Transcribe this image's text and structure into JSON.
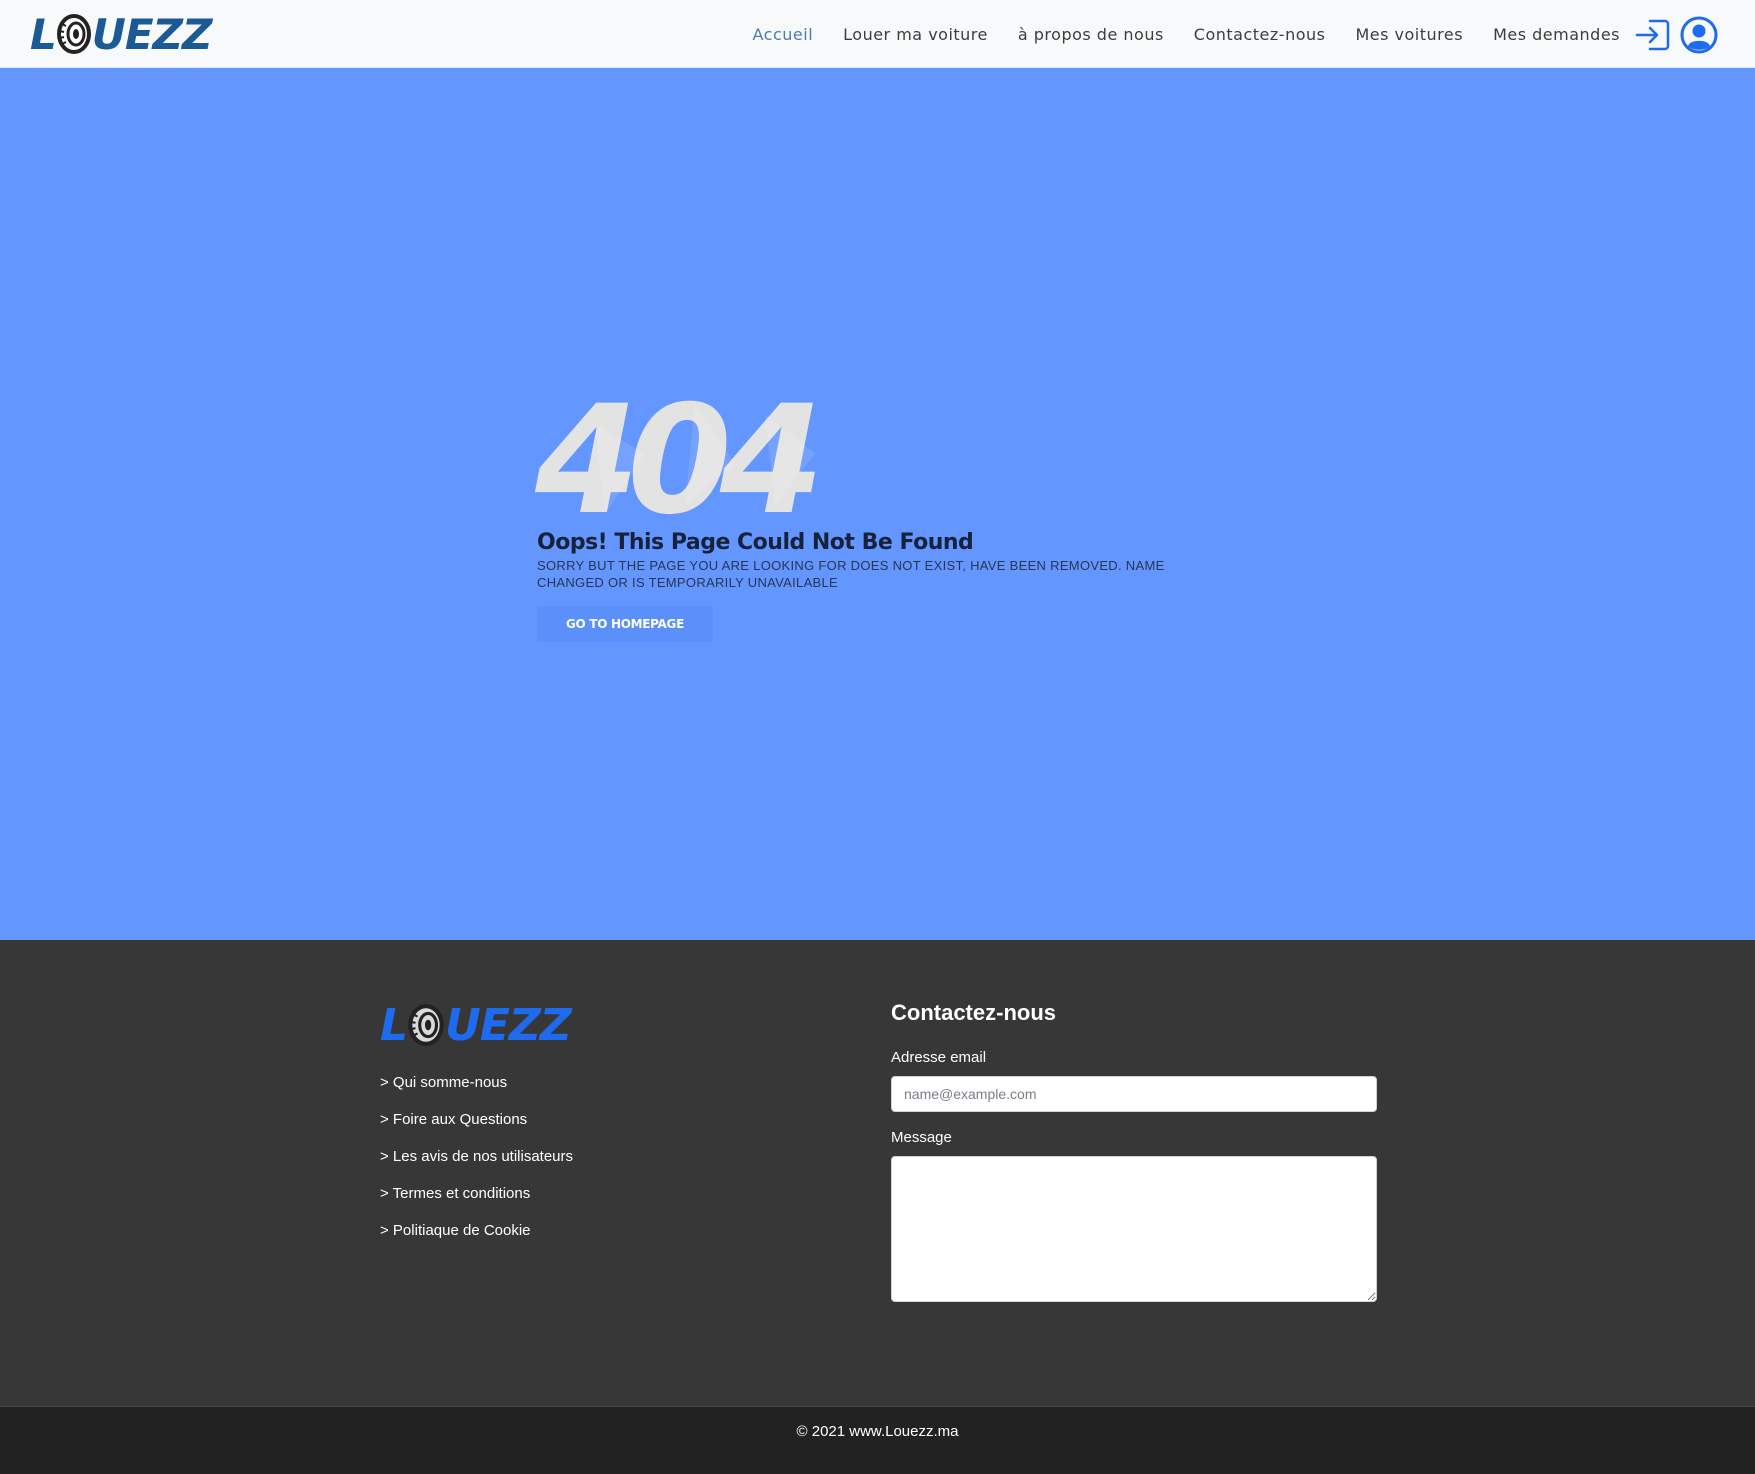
{
  "brand": {
    "logo_text_l": "L",
    "logo_text_rest": "UEZZ",
    "header_color": "#1b5a95",
    "footer_color": "#1e6bf0"
  },
  "nav": {
    "items": [
      {
        "label": "Accueil",
        "active": true
      },
      {
        "label": "Louer ma voiture",
        "active": false
      },
      {
        "label": "à propos de nous",
        "active": false
      },
      {
        "label": "Contactez-nous",
        "active": false
      },
      {
        "label": "Mes voitures",
        "active": false
      },
      {
        "label": "Mes demandes",
        "active": false
      }
    ],
    "active_color": "#4b7bb4",
    "login_icon": "login-arrow-icon",
    "user_icon": "user-circle-icon"
  },
  "error": {
    "code": "404",
    "title": "Oops! This Page Could Not Be Found",
    "message": "SORRY BUT THE PAGE YOU ARE LOOKING FOR DOES NOT EXIST, HAVE BEEN REMOVED. NAME CHANGED OR IS TEMPORARILY UNAVAILABLE",
    "button_label": "GO TO HOMEPAGE",
    "background_color": "#6396ff"
  },
  "footer": {
    "links": [
      "> Qui somme-nous",
      "> Foire aux Questions",
      "> Les avis de nos utilisateurs",
      "> Termes et conditions",
      "> Politiaque de Cookie"
    ],
    "contact": {
      "title": "Contactez-nous",
      "email_label": "Adresse email",
      "email_placeholder": "name@example.com",
      "email_value": "",
      "message_label": "Message",
      "message_value": ""
    },
    "copyright": "© 2021 www.Louezz.ma"
  }
}
